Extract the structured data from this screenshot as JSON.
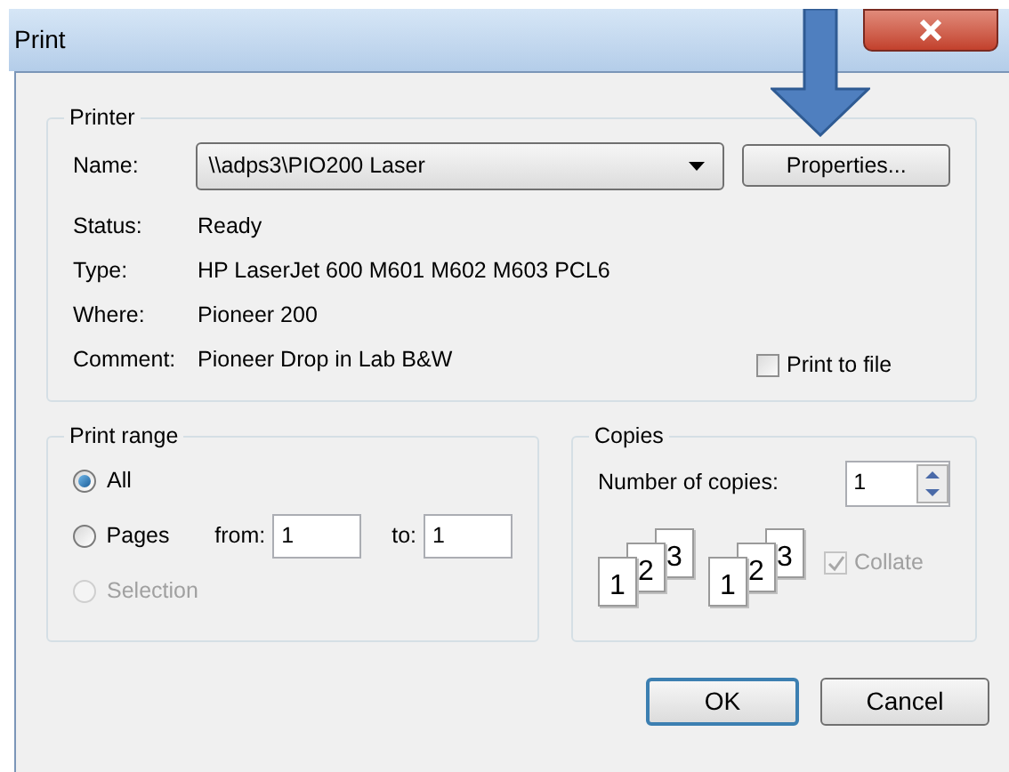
{
  "window": {
    "title": "Print"
  },
  "printer": {
    "group_label": "Printer",
    "name_label": "Name:",
    "name_value": "\\\\adps3\\PIO200 Laser",
    "properties_button": "Properties...",
    "info": [
      {
        "label": "Status:",
        "value": "Ready"
      },
      {
        "label": "Type:",
        "value": "HP LaserJet 600 M601 M602 M603 PCL6"
      },
      {
        "label": "Where:",
        "value": "Pioneer 200"
      },
      {
        "label": "Comment:",
        "value": "Pioneer Drop in Lab B&W"
      }
    ],
    "print_to_file": {
      "label": "Print to file",
      "checked": false
    }
  },
  "print_range": {
    "group_label": "Print range",
    "options": [
      {
        "label": "All",
        "selected": true,
        "disabled": false
      },
      {
        "label": "Pages",
        "selected": false,
        "disabled": false
      },
      {
        "label": "Selection",
        "selected": false,
        "disabled": true
      }
    ],
    "from_label": "from:",
    "from_value": "1",
    "to_label": "to:",
    "to_value": "1"
  },
  "copies": {
    "group_label": "Copies",
    "number_label": "Number of copies:",
    "number_value": "1",
    "collate_stacks": [
      [
        "1",
        "2",
        "3"
      ],
      [
        "1",
        "2",
        "3"
      ]
    ],
    "collate": {
      "label": "Collate",
      "checked": true,
      "disabled": true
    }
  },
  "buttons": [
    {
      "label": "OK",
      "default": true
    },
    {
      "label": "Cancel",
      "default": false
    }
  ]
}
